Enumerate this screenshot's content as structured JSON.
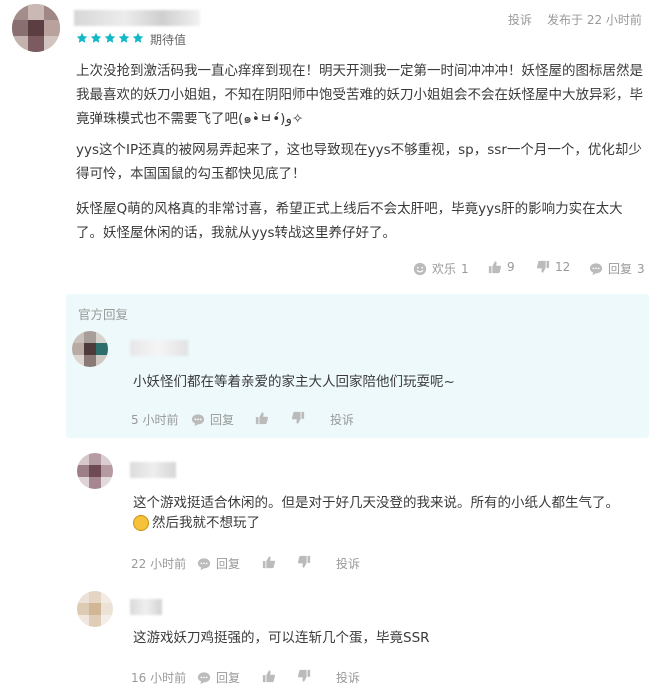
{
  "review": {
    "report_label": "投诉",
    "time_label": "发布于 22 小时前",
    "rating": 5,
    "rating_text": "期待值",
    "paragraphs": [
      "上次没抢到激活码我一直心痒痒到现在！明天开测我一定第一时间冲冲冲！妖怪屋的图标居然是我最喜欢的妖刀小姐姐，不知在阴阳师中饱受苦难的妖刀小姐姐会不会在妖怪屋中大放异彩，毕竟弹珠模式也不需要飞了吧(๑•̀ㅂ•́)و✧",
      "yys这个IP还真的被网易弄起来了，这也导致现在yys不够重视，sp，ssr一个月一个，优化却少得可怜，本国国鼠的勾玉都快见底了！",
      "妖怪屋Q萌的风格真的非常讨喜，希望正式上线后不会太肝吧，毕竟yys肝的影响力实在太大了。妖怪屋休闲的话，我就从yys转战这里养仔好了。"
    ],
    "actions": {
      "fun_label": "欢乐",
      "fun_count": "1",
      "up_count": "9",
      "down_count": "12",
      "reply_label": "回复",
      "reply_count": "3"
    }
  },
  "official_reply": {
    "section_title": "官方回复",
    "text": "小妖怪们都在等着亲爱的家主大人回家陪他们玩耍呢~",
    "time": "5 小时前",
    "reply_label": "回复",
    "report_label": "投诉"
  },
  "replies": [
    {
      "text_line1": "这个游戏挺适合休闲的。但是对于好几天没登的我来说。所有的小纸人都生气了。",
      "text_line2": "然后我就不想玩了",
      "emoji": "😄",
      "time": "22 小时前",
      "reply_label": "回复",
      "report_label": "投诉"
    },
    {
      "text_line1": "这游戏妖刀鸡挺强的，可以连斩几个蛋，毕竟SSR",
      "time": "16 小时前",
      "reply_label": "回复",
      "report_label": "投诉"
    }
  ],
  "colors": {
    "star": "#14b9c8",
    "official_bg": "#eef9fb",
    "muted": "#999999"
  },
  "icons": [
    "smile-icon",
    "thumb-up-icon",
    "thumb-down-icon",
    "comment-icon",
    "reply-icon",
    "emoji-grin-icon"
  ]
}
